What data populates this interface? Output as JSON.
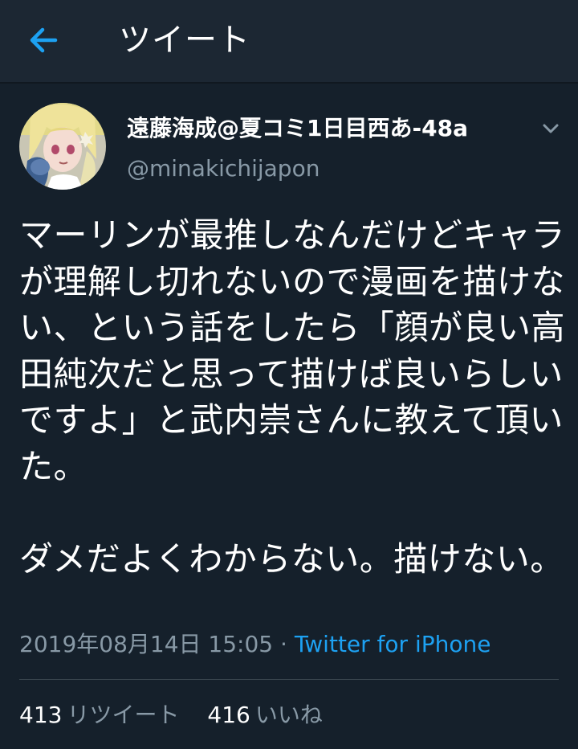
{
  "header": {
    "title": "ツイート",
    "back_icon": "back-arrow-icon",
    "accent_color": "#1da1f2"
  },
  "tweet": {
    "display_name": "遠藤海成@夏コミ1日目西あ-48a",
    "handle": "@minakichijapon",
    "text": "マーリンが最推しなんだけどキャラが理解し切れないので漫画を描けない、という話をしたら「顔が良い高田純次だと思って描けば良いらしいですよ」と武内崇さんに教えて頂いた。\n\nダメだよくわからない。描けない。",
    "timestamp": "2019年08月14日 15:05",
    "separator": " · ",
    "source": "Twitter for iPhone",
    "caret_icon": "chevron-down-icon"
  },
  "stats": {
    "retweets_count": "413",
    "retweets_label": "リツイート",
    "likes_count": "416",
    "likes_label": "いいね"
  },
  "colors": {
    "background": "#15202b",
    "header_background": "#1c2733",
    "secondary_text": "#8899a6",
    "link": "#1da1f2",
    "divider": "#38444d"
  }
}
